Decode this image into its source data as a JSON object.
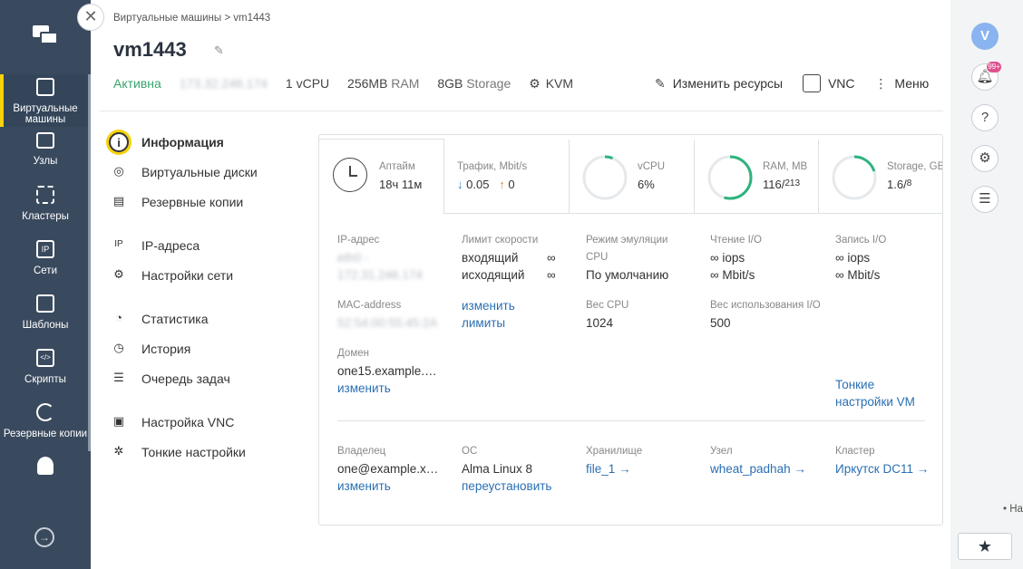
{
  "nav": {
    "items": [
      {
        "label": "Виртуальные машины"
      },
      {
        "label": "Узлы"
      },
      {
        "label": "Кластеры"
      },
      {
        "label": "Сети"
      },
      {
        "label": "Шаблоны"
      },
      {
        "label": "Скрипты"
      },
      {
        "label": "Резервные копии"
      }
    ]
  },
  "header": {
    "breadcrumb": "Виртуальные машины > vm1443",
    "title": "vm1443",
    "status": "Активна",
    "ip": "173.32.246.174",
    "vcpu": "1 vCPU",
    "ram_value": "256MB",
    "ram_unit": "RAM",
    "storage_value": "8GB",
    "storage_unit": "Storage",
    "hypervisor": "KVM",
    "action_resize": "Изменить ресурсы",
    "action_vnc": "VNC",
    "action_menu": "Меню"
  },
  "menu": {
    "items": [
      {
        "label": "Информация"
      },
      {
        "label": "Виртуальные диски"
      },
      {
        "label": "Резервные копии"
      },
      {
        "label": "IP-адреса"
      },
      {
        "label": "Настройки сети"
      },
      {
        "label": "Статистика"
      },
      {
        "label": "История"
      },
      {
        "label": "Очередь задач"
      },
      {
        "label": "Настройка VNC"
      },
      {
        "label": "Тонкие настройки"
      }
    ]
  },
  "stats": {
    "uptime_label": "Аптайм",
    "uptime_value": "18ч 11м",
    "traffic_label": "Трафик, Mbit/s",
    "traffic_down": "0.05",
    "traffic_up": "0",
    "vcpu_label": "vCPU",
    "vcpu_value": "6%",
    "vcpu_pct": 0.06,
    "ram_label": "RAM, MB",
    "ram_used": "116/",
    "ram_total": "213",
    "ram_pct": 0.545,
    "storage_label": "Storage, GB",
    "storage_used": "1.6/",
    "storage_total": "8",
    "storage_pct": 0.2
  },
  "info": {
    "ip_label": "IP-адрес",
    "ip_iface": "eth0 -",
    "ip_value": "172.31.246.174",
    "mac_label": "MAC-address",
    "mac_value": "52:54:00:55:45:2A",
    "domain_label": "Домен",
    "domain_value": "one15.example.…",
    "domain_edit": "изменить",
    "speed_label": "Лимит скорости",
    "speed_in": "входящий",
    "speed_in_val": "∞",
    "speed_out": "исходящий",
    "speed_out_val": "∞",
    "speed_edit": "изменить лимиты",
    "cpu_mode_label": "Режим эмуляции CPU",
    "cpu_mode_value": "По умолчанию",
    "cpu_weight_label": "Вес CPU",
    "cpu_weight_value": "1024",
    "io_read_label": "Чтение I/O",
    "io_read_iops": "∞ iops",
    "io_read_mbit": "∞ Mbit/s",
    "io_weight_label": "Вес использования I/O",
    "io_weight_value": "500",
    "io_write_label": "Запись I/O",
    "io_write_iops": "∞ iops",
    "io_write_mbit": "∞ Mbit/s",
    "fine_tune_link": "Тонкие настройки VM",
    "owner_label": "Владелец",
    "owner_value": "one@example.x…",
    "owner_edit": "изменить",
    "os_label": "ОС",
    "os_value": "Alma Linux 8",
    "os_reinstall": "переустановить",
    "storage_label": "Хранилище",
    "storage_value": "file_1 →",
    "node_label": "Узел",
    "node_value": "wheat_padhah →",
    "cluster_label": "Кластер",
    "cluster_value": "Иркутск DC11 →"
  },
  "rail": {
    "avatar_letter": "V",
    "notif_badge": "99+",
    "settings_label": "Настр…"
  },
  "colors": {
    "nav_bg": "#3a4a5e",
    "accent_yellow": "#f5d20a",
    "status_green": "#3aa46b",
    "ring_green": "#2fb37e",
    "link_blue": "#2a6fb3"
  }
}
